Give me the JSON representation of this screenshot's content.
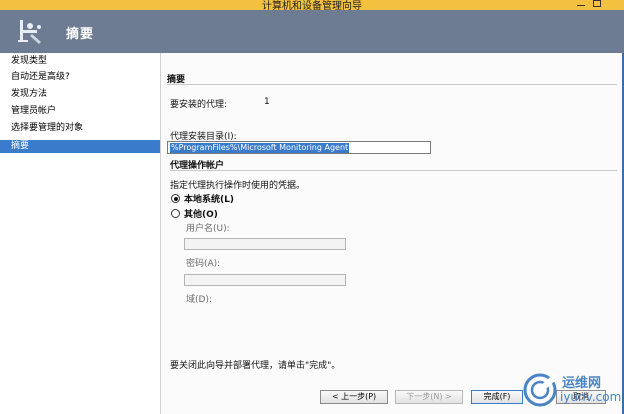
{
  "window": {
    "title": "计算机和设备管理向导"
  },
  "header": {
    "title": "摘要"
  },
  "sidebar": {
    "items": [
      {
        "label": "发现类型",
        "active": false
      },
      {
        "label": "自动还是高级?",
        "active": false
      },
      {
        "label": "发现方法",
        "active": false
      },
      {
        "label": "管理员帐户",
        "active": false
      },
      {
        "label": "选择要管理的对象",
        "active": false
      },
      {
        "label": "摘要",
        "active": true
      }
    ]
  },
  "main": {
    "section_title": "摘要",
    "agents_label": "要安装的代理:",
    "agents_count": "1",
    "install_dir_label": "代理安装目录(I):",
    "install_dir_value": "%ProgramFiles%\\Microsoft Monitoring Agent",
    "account_section_title": "代理操作帐户",
    "account_desc": "指定代理执行操作时使用的凭据。",
    "radio_local": "本地系统(L)",
    "radio_other": "其他(O)",
    "username_label": "用户名(U):",
    "password_label": "密码(A):",
    "domain_label": "域(D):",
    "footer_text": "要关闭此向导并部署代理，请单击\"完成\"。"
  },
  "buttons": {
    "prev": "< 上一步(P)",
    "next": "下一步(N) >",
    "finish": "完成(F)",
    "cancel": "取消"
  },
  "watermark": {
    "text": "运维网",
    "subtext": "iyunv.com"
  },
  "colors": {
    "header_bg": "#6d7b93",
    "accent": "#3a7bcc",
    "titlebar": "#f3c040"
  }
}
